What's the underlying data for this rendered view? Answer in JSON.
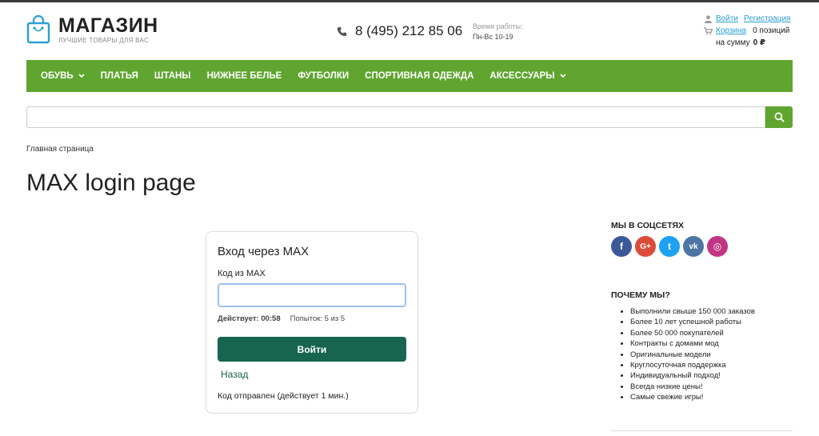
{
  "header": {
    "logo_title": "МАГАЗИН",
    "logo_subtitle": "ЛУЧШИЕ ТОВАРЫ ДЛЯ ВАС",
    "phone": "8 (495) 212 85 06",
    "hours_label": "Время работы:",
    "hours_value": "Пн-Вс 10-19",
    "login_link": "Войти",
    "register_link": "Регистрация",
    "cart_link": "Корзина",
    "cart_count": "0 позиций",
    "cart_sum_label": "на сумму",
    "cart_sum_value": "0 ₽"
  },
  "nav": {
    "items": [
      {
        "label": "ОБУВЬ",
        "has_dropdown": true
      },
      {
        "label": "ПЛАТЬЯ",
        "has_dropdown": false
      },
      {
        "label": "ШТАНЫ",
        "has_dropdown": false
      },
      {
        "label": "НИЖНЕЕ БЕЛЬЕ",
        "has_dropdown": false
      },
      {
        "label": "ФУТБОЛКИ",
        "has_dropdown": false
      },
      {
        "label": "СПОРТИВНАЯ ОДЕЖДА",
        "has_dropdown": false
      },
      {
        "label": "АКСЕССУАРЫ",
        "has_dropdown": true
      }
    ]
  },
  "search": {
    "placeholder": "",
    "value": ""
  },
  "breadcrumb": "Главная страница",
  "page_title": "MAX login page",
  "login_card": {
    "title": "Вход через MAX",
    "code_label": "Код из MAX",
    "code_value": "",
    "timer_label": "Действует: 00:58",
    "attempts": "Попыток: 5 из 5",
    "submit_label": "Войти",
    "back_label": "Назад",
    "status": "Код отправлен (действует 1 мин.)"
  },
  "sidebar": {
    "social_heading": "МЫ В СОЦСЕТЯХ",
    "socials": [
      {
        "name": "facebook-icon",
        "glyph": "f",
        "color": "#3b5998"
      },
      {
        "name": "google-plus-icon",
        "glyph": "G+",
        "color": "#dd4b39"
      },
      {
        "name": "twitter-icon",
        "glyph": "t",
        "color": "#1da1f2"
      },
      {
        "name": "vk-icon",
        "glyph": "vk",
        "color": "#4c75a3"
      },
      {
        "name": "instagram-icon",
        "glyph": "◎",
        "color": "#c13584"
      }
    ],
    "why_heading": "ПОЧЕМУ МЫ?",
    "why_items": [
      "Выполнили свыше 150 000 заказов",
      "Более 10 лет успешной работы",
      "Более 50 000 покупателей",
      "Контракты с домами мод",
      "Оригинальные модели",
      "Круглосуточная поддержка",
      "Индивидуальный подход!",
      "Всегда низкие цены!",
      "Самые свежие игры!"
    ]
  },
  "colors": {
    "nav_green": "#5fa530",
    "button_green": "#17644f",
    "link_blue": "#2a9fd6"
  }
}
